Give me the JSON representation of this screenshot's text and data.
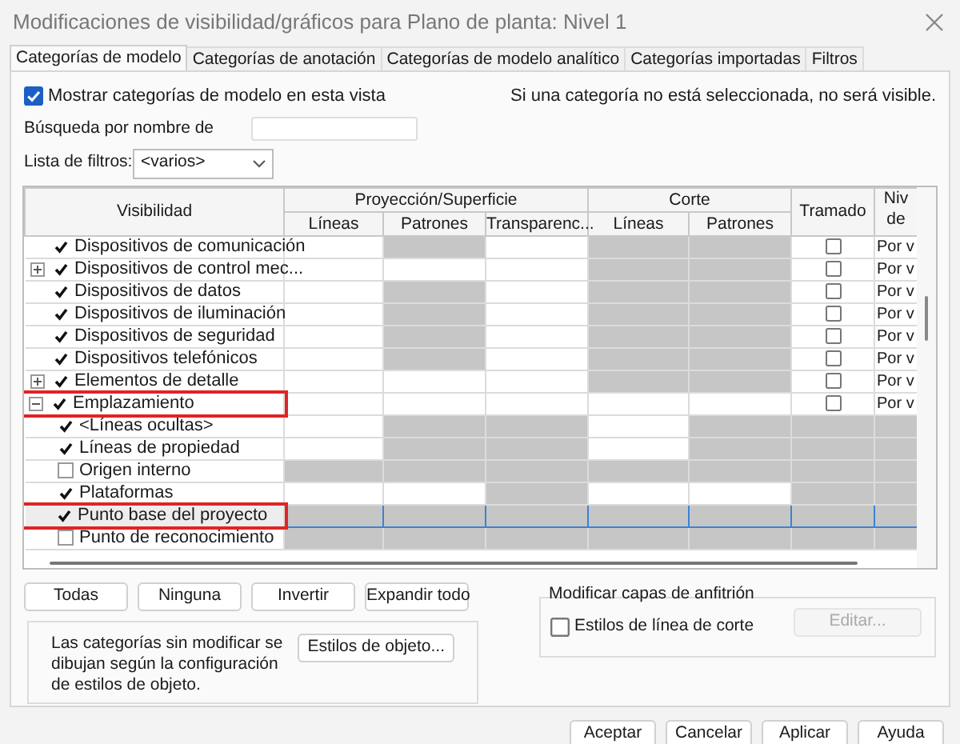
{
  "window": {
    "title": "Modificaciones de visibilidad/gráficos para Plano de planta: Nivel 1"
  },
  "tabs": [
    {
      "label": "Categorías de modelo",
      "selected": true
    },
    {
      "label": "Categorías de anotación",
      "selected": false
    },
    {
      "label": "Categorías de modelo analítico",
      "selected": false
    },
    {
      "label": "Categorías importadas",
      "selected": false
    },
    {
      "label": "Filtros",
      "selected": false
    }
  ],
  "show_categories": {
    "label": "Mostrar categorías de modelo en esta vista",
    "checked": true
  },
  "hint": "Si una categoría no está seleccionada, no será visible.",
  "search": {
    "label": "Búsqueda por nombre de"
  },
  "filter_list": {
    "label": "Lista de filtros:",
    "value": "<varios>"
  },
  "table": {
    "columns": {
      "visibility": "Visibilidad",
      "projection": "Proyección/Superficie",
      "cut": "Corte",
      "halftone": "Tramado",
      "detail_level": "Niv de",
      "sub": [
        "Líneas",
        "Patrones",
        "Transparenc...",
        "Líneas",
        "Patrones"
      ]
    },
    "rows": [
      {
        "label": "Dispositivos de comunicación",
        "checked": true,
        "selected": false,
        "highlighted": false,
        "shaded": [
          false,
          true,
          false,
          true,
          true
        ],
        "halftone": false,
        "detail_level": "Por v"
      },
      {
        "label": "Dispositivos de control mec...",
        "checked": true,
        "expanded": false,
        "selected": false,
        "highlighted": false,
        "shaded": [
          false,
          false,
          false,
          true,
          true
        ],
        "halftone": false,
        "detail_level": "Por v"
      },
      {
        "label": "Dispositivos de datos",
        "checked": true,
        "selected": false,
        "highlighted": false,
        "shaded": [
          false,
          true,
          false,
          true,
          true
        ],
        "halftone": false,
        "detail_level": "Por v"
      },
      {
        "label": "Dispositivos de iluminación",
        "checked": true,
        "selected": false,
        "highlighted": false,
        "shaded": [
          false,
          true,
          false,
          true,
          true
        ],
        "halftone": false,
        "detail_level": "Por v"
      },
      {
        "label": "Dispositivos de seguridad",
        "checked": true,
        "selected": false,
        "highlighted": false,
        "shaded": [
          false,
          true,
          false,
          true,
          true
        ],
        "halftone": false,
        "detail_level": "Por v"
      },
      {
        "label": "Dispositivos telefónicos",
        "checked": true,
        "selected": false,
        "highlighted": false,
        "shaded": [
          false,
          true,
          false,
          true,
          true
        ],
        "halftone": false,
        "detail_level": "Por v"
      },
      {
        "label": "Elementos de detalle",
        "checked": true,
        "expanded": false,
        "selected": false,
        "highlighted": false,
        "shaded": [
          false,
          false,
          false,
          true,
          true
        ],
        "halftone": false,
        "detail_level": "Por v"
      },
      {
        "label": "Emplazamiento",
        "checked": true,
        "expanded": true,
        "selected": false,
        "highlighted": true,
        "shaded": [
          false,
          false,
          false,
          false,
          false
        ],
        "halftone": false,
        "detail_level": "Por v",
        "children": [
          {
            "label": "<Líneas ocultas>",
            "checked": true,
            "selected": false,
            "highlighted": false,
            "shaded": [
              false,
              true,
              true,
              false,
              true
            ]
          },
          {
            "label": "Líneas de propiedad",
            "checked": true,
            "selected": false,
            "highlighted": false,
            "shaded": [
              false,
              true,
              true,
              false,
              true
            ]
          },
          {
            "label": "Origen interno",
            "checked": false,
            "selected": false,
            "highlighted": false,
            "shaded": [
              true,
              true,
              true,
              true,
              true
            ]
          },
          {
            "label": "Plataformas",
            "checked": true,
            "selected": false,
            "highlighted": false,
            "shaded": [
              false,
              false,
              true,
              false,
              false
            ]
          },
          {
            "label": "Punto base del proyecto",
            "checked": true,
            "selected": true,
            "highlighted": true,
            "shaded": [
              true,
              true,
              true,
              true,
              true
            ]
          },
          {
            "label": "Punto de reconocimiento",
            "checked": false,
            "selected": false,
            "highlighted": false,
            "shaded": [
              true,
              true,
              true,
              true,
              true
            ]
          }
        ]
      }
    ]
  },
  "bulk_buttons": [
    "Todas",
    "Ninguna",
    "Invertir",
    "Expandir todo"
  ],
  "note": {
    "text": "Las categorías sin modificar se dibujan según la configuración de estilos de objeto.",
    "button": "Estilos de objeto..."
  },
  "host_layers": {
    "title": "Modificar capas de anfitrión",
    "checkbox": {
      "label": "Estilos de línea de corte",
      "checked": false
    },
    "edit_button": {
      "label": "Editar...",
      "disabled": true
    }
  },
  "dialog_buttons": [
    "Aceptar",
    "Cancelar",
    "Aplicar",
    "Ayuda"
  ]
}
